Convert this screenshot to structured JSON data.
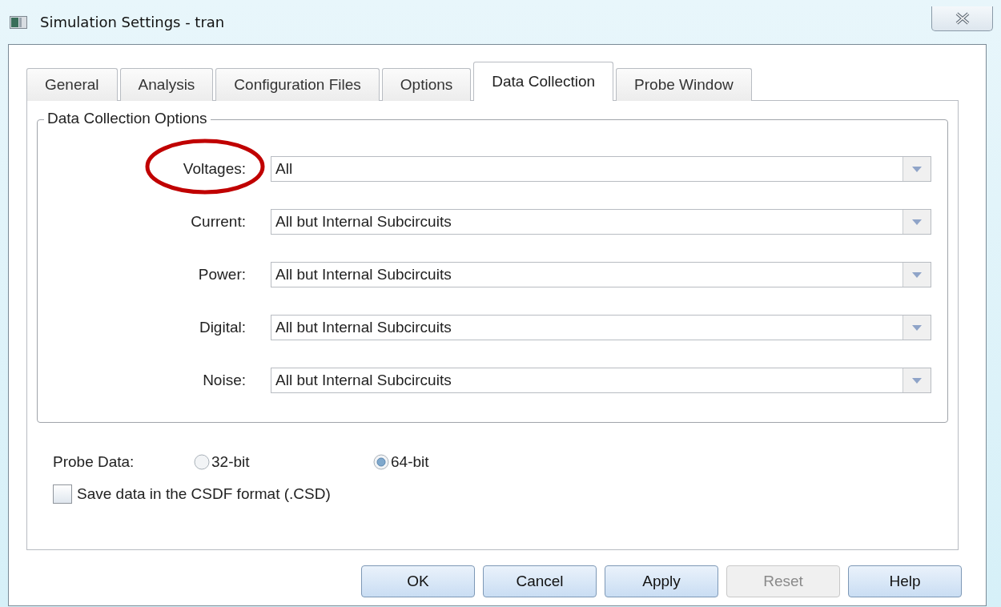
{
  "window": {
    "title": "Simulation Settings - tran"
  },
  "tabs": [
    {
      "label": "General",
      "selected": false
    },
    {
      "label": "Analysis",
      "selected": false
    },
    {
      "label": "Configuration Files",
      "selected": false
    },
    {
      "label": "Options",
      "selected": false
    },
    {
      "label": "Data Collection",
      "selected": true
    },
    {
      "label": "Probe Window",
      "selected": false
    }
  ],
  "group": {
    "title": "Data Collection Options",
    "fields": [
      {
        "label": "Voltages:",
        "value": "All",
        "highlighted": true
      },
      {
        "label": "Current:",
        "value": "All but Internal Subcircuits",
        "highlighted": false
      },
      {
        "label": "Power:",
        "value": "All but Internal Subcircuits",
        "highlighted": false
      },
      {
        "label": "Digital:",
        "value": "All but Internal Subcircuits",
        "highlighted": false
      },
      {
        "label": "Noise:",
        "value": "All but Internal Subcircuits",
        "highlighted": false
      }
    ]
  },
  "probe_data": {
    "label": "Probe Data:",
    "options": [
      {
        "label": "32-bit",
        "selected": false
      },
      {
        "label": "64-bit",
        "selected": true
      }
    ]
  },
  "csdf": {
    "label": "Save data in the CSDF format (.CSD)",
    "checked": false
  },
  "buttons": [
    {
      "label": "OK",
      "disabled": false
    },
    {
      "label": "Cancel",
      "disabled": false
    },
    {
      "label": "Apply",
      "disabled": false
    },
    {
      "label": "Reset",
      "disabled": true
    },
    {
      "label": "Help",
      "disabled": false
    }
  ]
}
